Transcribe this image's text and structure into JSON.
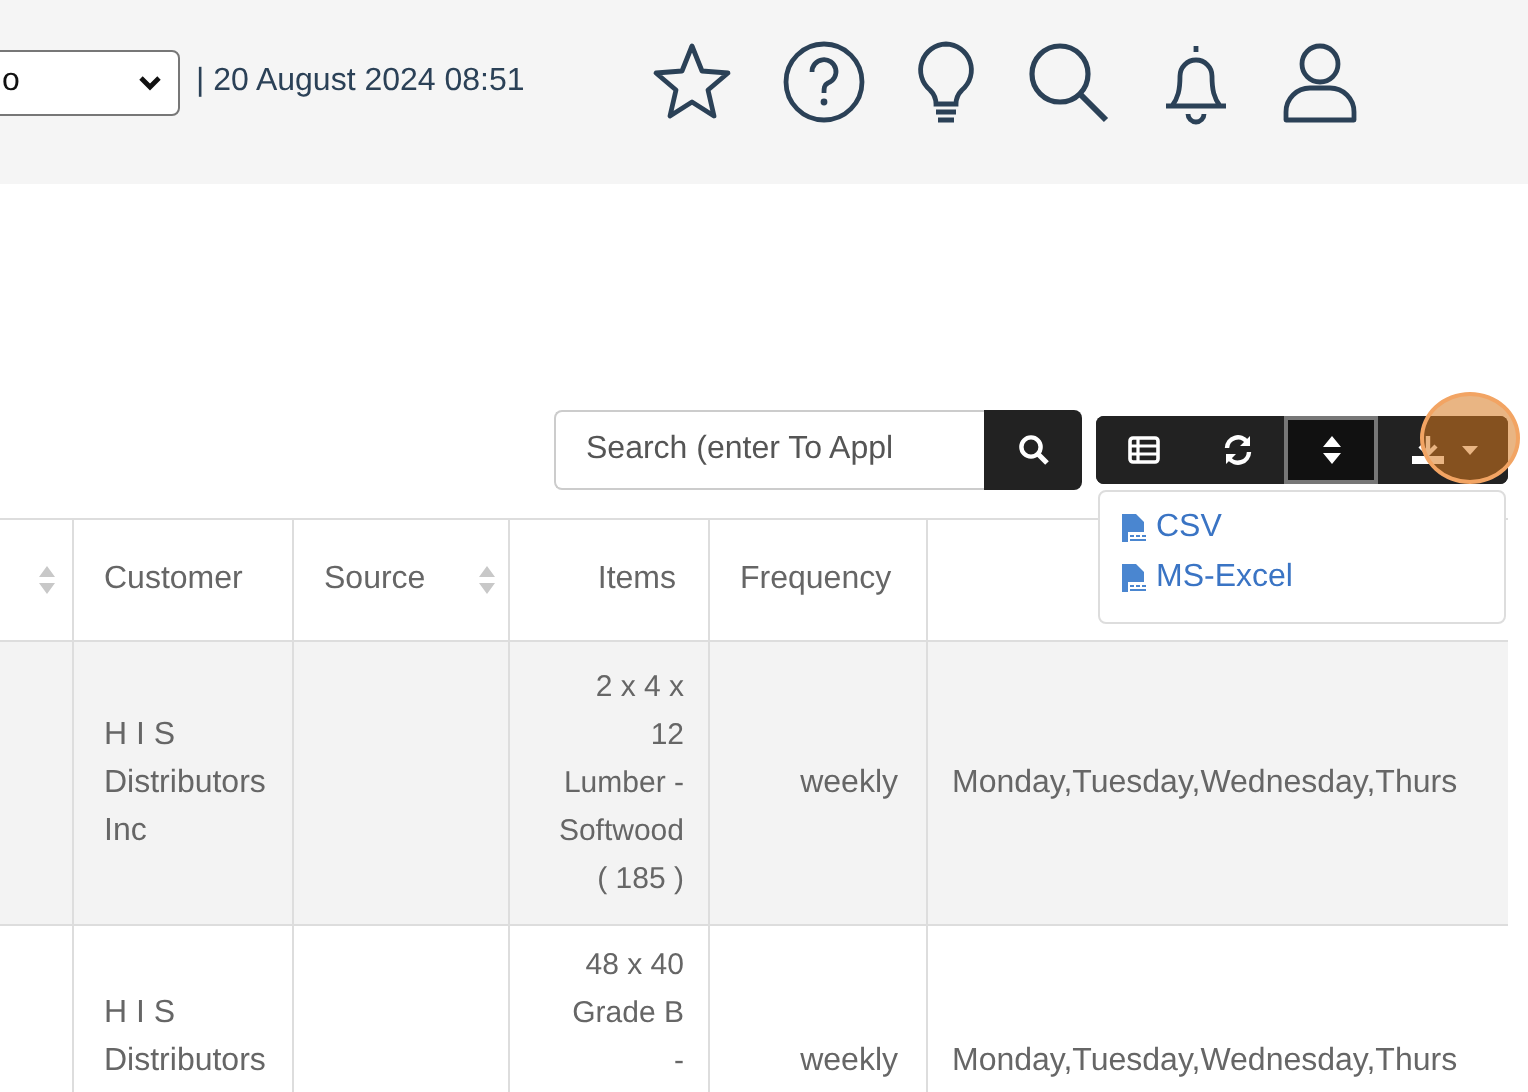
{
  "header": {
    "select_value": "o",
    "datetime": "| 20 August 2024 08:51"
  },
  "search": {
    "placeholder": "Search (enter To Appl"
  },
  "toolbar": [
    {
      "kind": "table",
      "selected": false
    },
    {
      "kind": "refresh",
      "selected": false
    },
    {
      "kind": "sort",
      "selected": true
    },
    {
      "kind": "download",
      "selected": false
    }
  ],
  "export_menu": [
    {
      "label": "CSV"
    },
    {
      "label": "MS-Excel"
    }
  ],
  "table": {
    "columns": [
      {
        "sortable": true
      },
      {
        "label": "Customer",
        "sortable": false
      },
      {
        "label": "Source",
        "sortable": true
      },
      {
        "label": "Items",
        "sortable": false
      },
      {
        "label": "Frequency",
        "sortable": false
      },
      {
        "sortable": false
      }
    ],
    "rows": [
      {
        "customer": "H I S Distributors Inc",
        "items": "2 x 4 x 12 Lumber - Softwood ( 185 )",
        "frequency": "weekly",
        "column_6": "Monday,Tuesday,Wednesday,Thurs"
      },
      {
        "customer": "H I S Distributors",
        "items": "48 x 40 Grade B -",
        "frequency": "weekly",
        "column_6": "Monday,Tuesday,Wednesday,Thurs"
      }
    ]
  }
}
